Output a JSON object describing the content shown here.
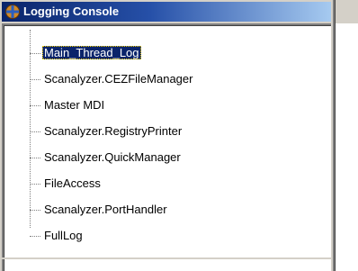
{
  "window": {
    "title": "Logging Console",
    "title_icon": "globe-icon",
    "colors": {
      "titlebar_start": "#0a246a",
      "titlebar_end": "#a6caf0",
      "selection": "#0a246a",
      "chrome": "#d4d0c8"
    }
  },
  "tree": {
    "items": [
      {
        "label": "Main_Thread_Log",
        "selected": true
      },
      {
        "label": "Scanalyzer.CEZFileManager",
        "selected": false
      },
      {
        "label": "Master MDI",
        "selected": false
      },
      {
        "label": "Scanalyzer.RegistryPrinter",
        "selected": false
      },
      {
        "label": "Scanalyzer.QuickManager",
        "selected": false
      },
      {
        "label": "FileAccess",
        "selected": false
      },
      {
        "label": "Scanalyzer.PortHandler",
        "selected": false
      },
      {
        "label": "FullLog",
        "selected": false
      }
    ]
  }
}
